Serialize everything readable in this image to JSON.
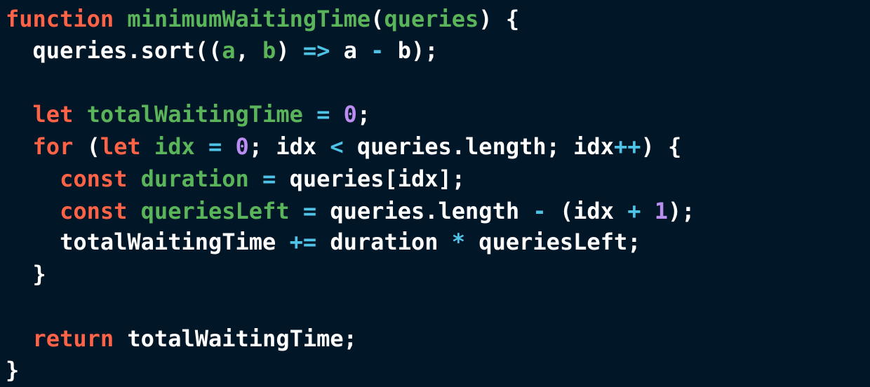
{
  "colors": {
    "background": "#011627",
    "keyword": "#ff6347",
    "identifier": "#5ab45a",
    "operator": "#4fc3e6",
    "number": "#b98ef0",
    "plain": "#ffffff"
  },
  "code": {
    "lines": [
      {
        "tokens": [
          {
            "t": "function",
            "c": "kw"
          },
          {
            "t": " ",
            "c": "pl"
          },
          {
            "t": "minimumWaitingTime",
            "c": "fn"
          },
          {
            "t": "(",
            "c": "pl"
          },
          {
            "t": "queries",
            "c": "fn"
          },
          {
            "t": ") {",
            "c": "pl"
          }
        ]
      },
      {
        "tokens": [
          {
            "t": "  queries.sort((",
            "c": "pl"
          },
          {
            "t": "a",
            "c": "fn"
          },
          {
            "t": ", ",
            "c": "pl"
          },
          {
            "t": "b",
            "c": "fn"
          },
          {
            "t": ") ",
            "c": "pl"
          },
          {
            "t": "=>",
            "c": "op"
          },
          {
            "t": " a ",
            "c": "pl"
          },
          {
            "t": "-",
            "c": "op"
          },
          {
            "t": " b);",
            "c": "pl"
          }
        ]
      },
      {
        "tokens": []
      },
      {
        "tokens": [
          {
            "t": "  ",
            "c": "pl"
          },
          {
            "t": "let",
            "c": "kw"
          },
          {
            "t": " ",
            "c": "pl"
          },
          {
            "t": "totalWaitingTime",
            "c": "fn"
          },
          {
            "t": " ",
            "c": "pl"
          },
          {
            "t": "=",
            "c": "op"
          },
          {
            "t": " ",
            "c": "pl"
          },
          {
            "t": "0",
            "c": "num"
          },
          {
            "t": ";",
            "c": "pl"
          }
        ]
      },
      {
        "tokens": [
          {
            "t": "  ",
            "c": "pl"
          },
          {
            "t": "for",
            "c": "kw"
          },
          {
            "t": " (",
            "c": "pl"
          },
          {
            "t": "let",
            "c": "kw"
          },
          {
            "t": " ",
            "c": "pl"
          },
          {
            "t": "idx",
            "c": "fn"
          },
          {
            "t": " ",
            "c": "pl"
          },
          {
            "t": "=",
            "c": "op"
          },
          {
            "t": " ",
            "c": "pl"
          },
          {
            "t": "0",
            "c": "num"
          },
          {
            "t": "; idx ",
            "c": "pl"
          },
          {
            "t": "<",
            "c": "op"
          },
          {
            "t": " queries.length; idx",
            "c": "pl"
          },
          {
            "t": "++",
            "c": "op"
          },
          {
            "t": ") {",
            "c": "pl"
          }
        ]
      },
      {
        "tokens": [
          {
            "t": "    ",
            "c": "pl"
          },
          {
            "t": "const",
            "c": "kw"
          },
          {
            "t": " ",
            "c": "pl"
          },
          {
            "t": "duration",
            "c": "fn"
          },
          {
            "t": " ",
            "c": "pl"
          },
          {
            "t": "=",
            "c": "op"
          },
          {
            "t": " queries[idx];",
            "c": "pl"
          }
        ]
      },
      {
        "tokens": [
          {
            "t": "    ",
            "c": "pl"
          },
          {
            "t": "const",
            "c": "kw"
          },
          {
            "t": " ",
            "c": "pl"
          },
          {
            "t": "queriesLeft",
            "c": "fn"
          },
          {
            "t": " ",
            "c": "pl"
          },
          {
            "t": "=",
            "c": "op"
          },
          {
            "t": " queries.length ",
            "c": "pl"
          },
          {
            "t": "-",
            "c": "op"
          },
          {
            "t": " (idx ",
            "c": "pl"
          },
          {
            "t": "+",
            "c": "op"
          },
          {
            "t": " ",
            "c": "pl"
          },
          {
            "t": "1",
            "c": "num"
          },
          {
            "t": ");",
            "c": "pl"
          }
        ]
      },
      {
        "tokens": [
          {
            "t": "    totalWaitingTime ",
            "c": "pl"
          },
          {
            "t": "+=",
            "c": "op"
          },
          {
            "t": " duration ",
            "c": "pl"
          },
          {
            "t": "*",
            "c": "op"
          },
          {
            "t": " queriesLeft;",
            "c": "pl"
          }
        ]
      },
      {
        "tokens": [
          {
            "t": "  }",
            "c": "pl"
          }
        ]
      },
      {
        "tokens": []
      },
      {
        "tokens": [
          {
            "t": "  ",
            "c": "pl"
          },
          {
            "t": "return",
            "c": "kw"
          },
          {
            "t": " totalWaitingTime;",
            "c": "pl"
          }
        ]
      },
      {
        "tokens": [
          {
            "t": "}",
            "c": "pl"
          }
        ]
      }
    ]
  }
}
